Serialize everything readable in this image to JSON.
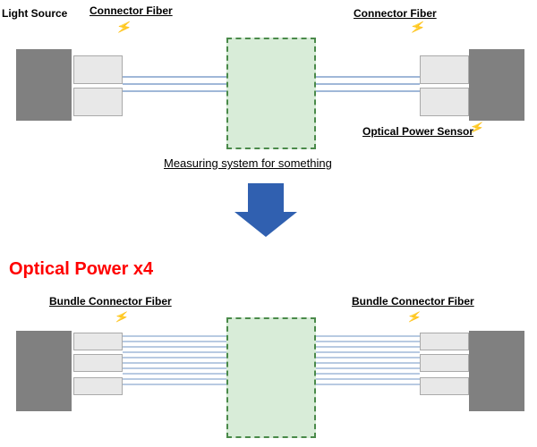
{
  "top_diagram": {
    "light_source_label": "Light Source",
    "connector_fiber_left_label": "Connector Fiber",
    "connector_fiber_right_label": "Connector Fiber",
    "optical_power_sensor_label": "Optical Power Sensor",
    "measuring_system_label": "Measuring system for something"
  },
  "middle": {
    "optical_power_label": "Optical Power x4"
  },
  "bottom_diagram": {
    "bundle_left_label": "Bundle Connector Fiber",
    "bundle_right_label": "Bundle Connector Fiber"
  },
  "colors": {
    "gray_box": "#808080",
    "connector": "#e8e8e8",
    "fiber_line": "#a0b8d8",
    "green_box_fill": "#d8ecd8",
    "green_box_border": "#4a8a4a",
    "arrow": "#3060b0",
    "optical_power_text": "red",
    "lightning": "#4444cc"
  }
}
